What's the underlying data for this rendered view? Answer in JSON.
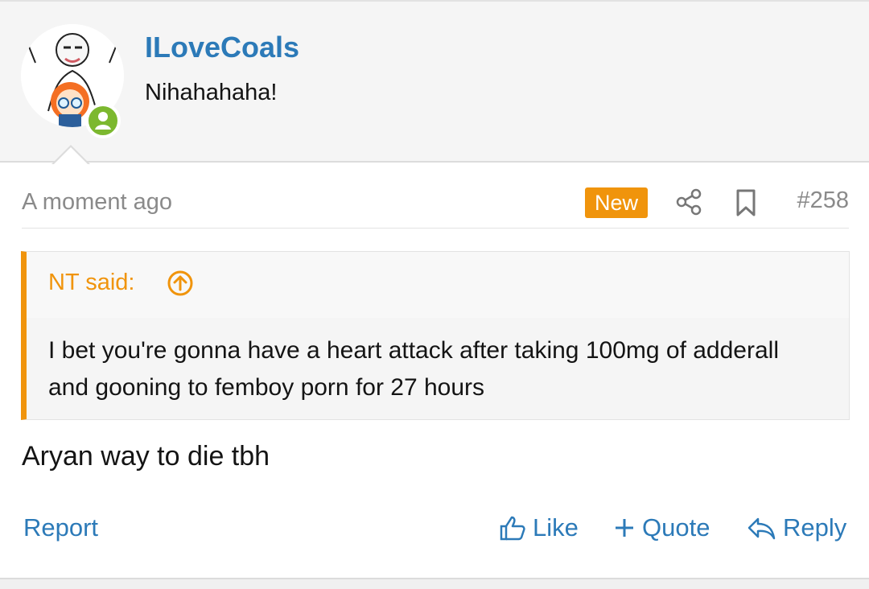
{
  "post": {
    "author": {
      "username": "ILoveCoals",
      "title": "Nihahahaha!",
      "avatar_icon": "user-avatar",
      "status": "online"
    },
    "meta": {
      "timestamp": "A moment ago",
      "new_badge": "New",
      "share_icon": "share-icon",
      "bookmark_icon": "bookmark-icon",
      "post_number": "#258"
    },
    "quote": {
      "author_label": "NT said:",
      "jump_icon": "arrow-up-circle-icon",
      "text": "I bet you're gonna have a heart attack after taking 100mg of adderall and gooning to femboy porn for 27 hours"
    },
    "message": "Aryan way to die tbh",
    "actions": {
      "report": "Report",
      "like": "Like",
      "quote": "Quote",
      "reply": "Reply"
    },
    "colors": {
      "link": "#2c7ab8",
      "accent": "#f0940c",
      "online": "#7cb82f",
      "muted": "#8a8a8a"
    }
  }
}
